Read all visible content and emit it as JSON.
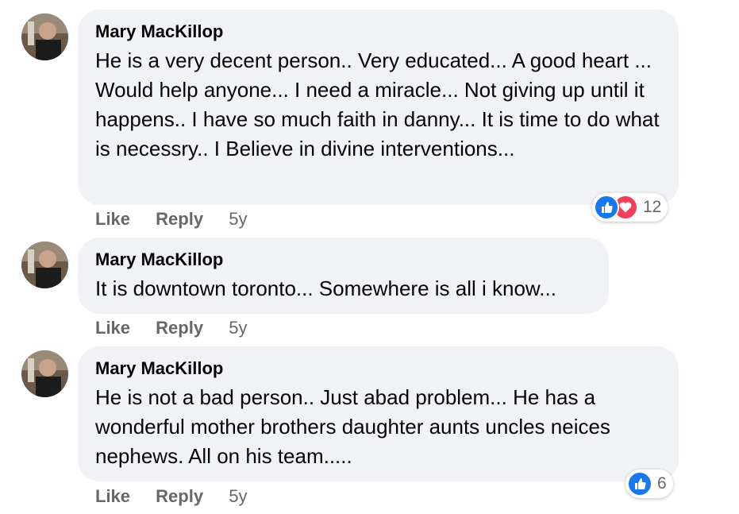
{
  "comments": [
    {
      "author": "Mary MacKillop",
      "text": "He is a very decent person.. Very educated... A good heart ... Would help anyone... I need a miracle... Not giving up until it happens.. I have so much faith in danny... It is time to do what is necessry.. I Believe in divine interventions...",
      "like_label": "Like",
      "reply_label": "Reply",
      "time": "5y",
      "reactions": {
        "icons": [
          "like-icon",
          "love-icon"
        ],
        "count": "12"
      }
    },
    {
      "author": "Mary MacKillop",
      "text": "It is downtown toronto... Somewhere is all i know...",
      "like_label": "Like",
      "reply_label": "Reply",
      "time": "5y"
    },
    {
      "author": "Mary MacKillop",
      "text": "He is not a bad person.. Just abad problem... He has a wonderful mother brothers daughter aunts uncles neices nephews. All on his team.....",
      "like_label": "Like",
      "reply_label": "Reply",
      "time": "5y",
      "reactions": {
        "icons": [
          "like-icon"
        ],
        "count": "6"
      }
    }
  ],
  "colors": {
    "bubble": "#f0f2f5",
    "action_text": "#65676b",
    "like_blue": "#1877f2",
    "love_red": "#f33e58"
  }
}
